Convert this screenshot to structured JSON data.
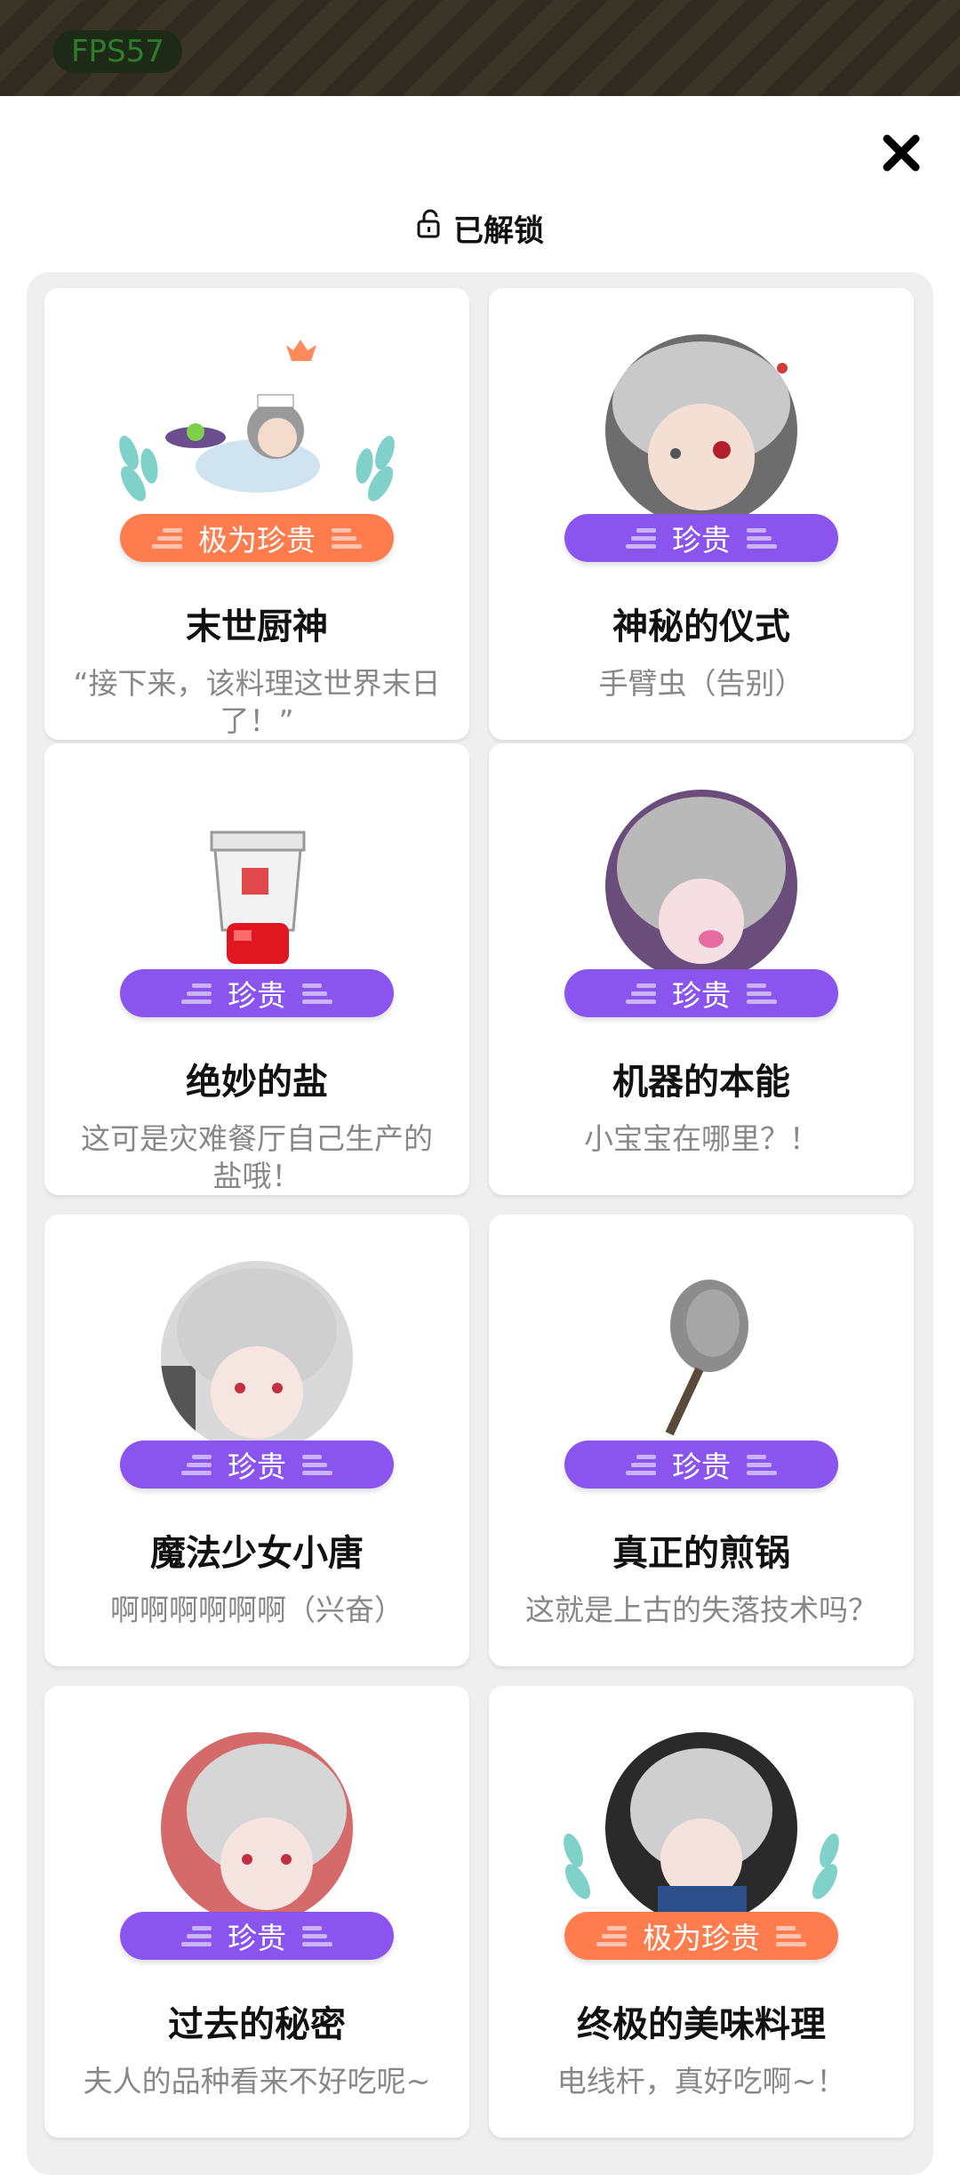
{
  "status": {
    "fps": "FPS57"
  },
  "header": {
    "title": "已解锁",
    "close_icon": "close-icon",
    "lock_icon": "unlock-icon"
  },
  "colors": {
    "rare": "#8a55ee",
    "very_rare": "#ff7c4f",
    "panel": "#efefef"
  },
  "cards": [
    {
      "title": "末世厨神",
      "desc": "“接下来，该料理这世界末日了！”",
      "rarity": "极为珍贵",
      "rarity_color": "orange",
      "icon": "chef-character-icon"
    },
    {
      "title": "神秘的仪式",
      "desc": "手臂虫（告别）",
      "rarity": "珍贵",
      "rarity_color": "purple",
      "icon": "character-portrait-icon"
    },
    {
      "title": "绝妙的盐",
      "desc": "这可是灾难餐厅自己生产的盐哦！",
      "rarity": "珍贵",
      "rarity_color": "purple",
      "icon": "salt-shaker-icon"
    },
    {
      "title": "机器的本能",
      "desc": "小宝宝在哪里？！",
      "rarity": "珍贵",
      "rarity_color": "purple",
      "icon": "character-portrait-icon"
    },
    {
      "title": "魔法少女小唐",
      "desc": "啊啊啊啊啊啊（兴奋）",
      "rarity": "珍贵",
      "rarity_color": "purple",
      "icon": "character-portrait-icon"
    },
    {
      "title": "真正的煎锅",
      "desc": "这就是上古的失落技术吗？",
      "rarity": "珍贵",
      "rarity_color": "purple",
      "icon": "frying-pan-icon"
    },
    {
      "title": "过去的秘密",
      "desc": "夫人的品种看来不好吃呢~",
      "rarity": "珍贵",
      "rarity_color": "purple",
      "icon": "character-portrait-icon"
    },
    {
      "title": "终极的美味料理",
      "desc": "电线杆，真好吃啊~！",
      "rarity": "极为珍贵",
      "rarity_color": "orange",
      "icon": "character-portrait-icon"
    }
  ]
}
